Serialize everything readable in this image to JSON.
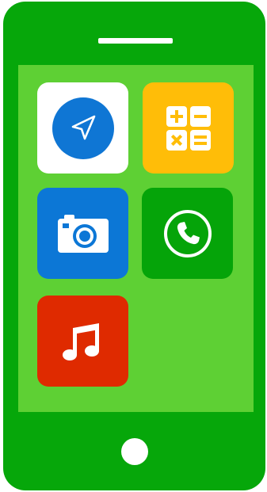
{
  "device": {
    "colors": {
      "body": "#06a70a",
      "screen": "#5ed034"
    }
  },
  "apps": [
    {
      "name": "maps",
      "icon": "navigation-arrow-icon",
      "tile_color": "#ffffff",
      "accent": "#0f76d4"
    },
    {
      "name": "calculator",
      "icon": "calculator-icon",
      "tile_color": "#ffbd08",
      "accent": "#ffffff"
    },
    {
      "name": "camera",
      "icon": "camera-icon",
      "tile_color": "#0c77d6",
      "accent": "#ffffff"
    },
    {
      "name": "phone",
      "icon": "phone-call-icon",
      "tile_color": "#05a409",
      "accent": "#ffffff"
    },
    {
      "name": "music",
      "icon": "music-note-icon",
      "tile_color": "#df2a00",
      "accent": "#ffffff"
    }
  ]
}
